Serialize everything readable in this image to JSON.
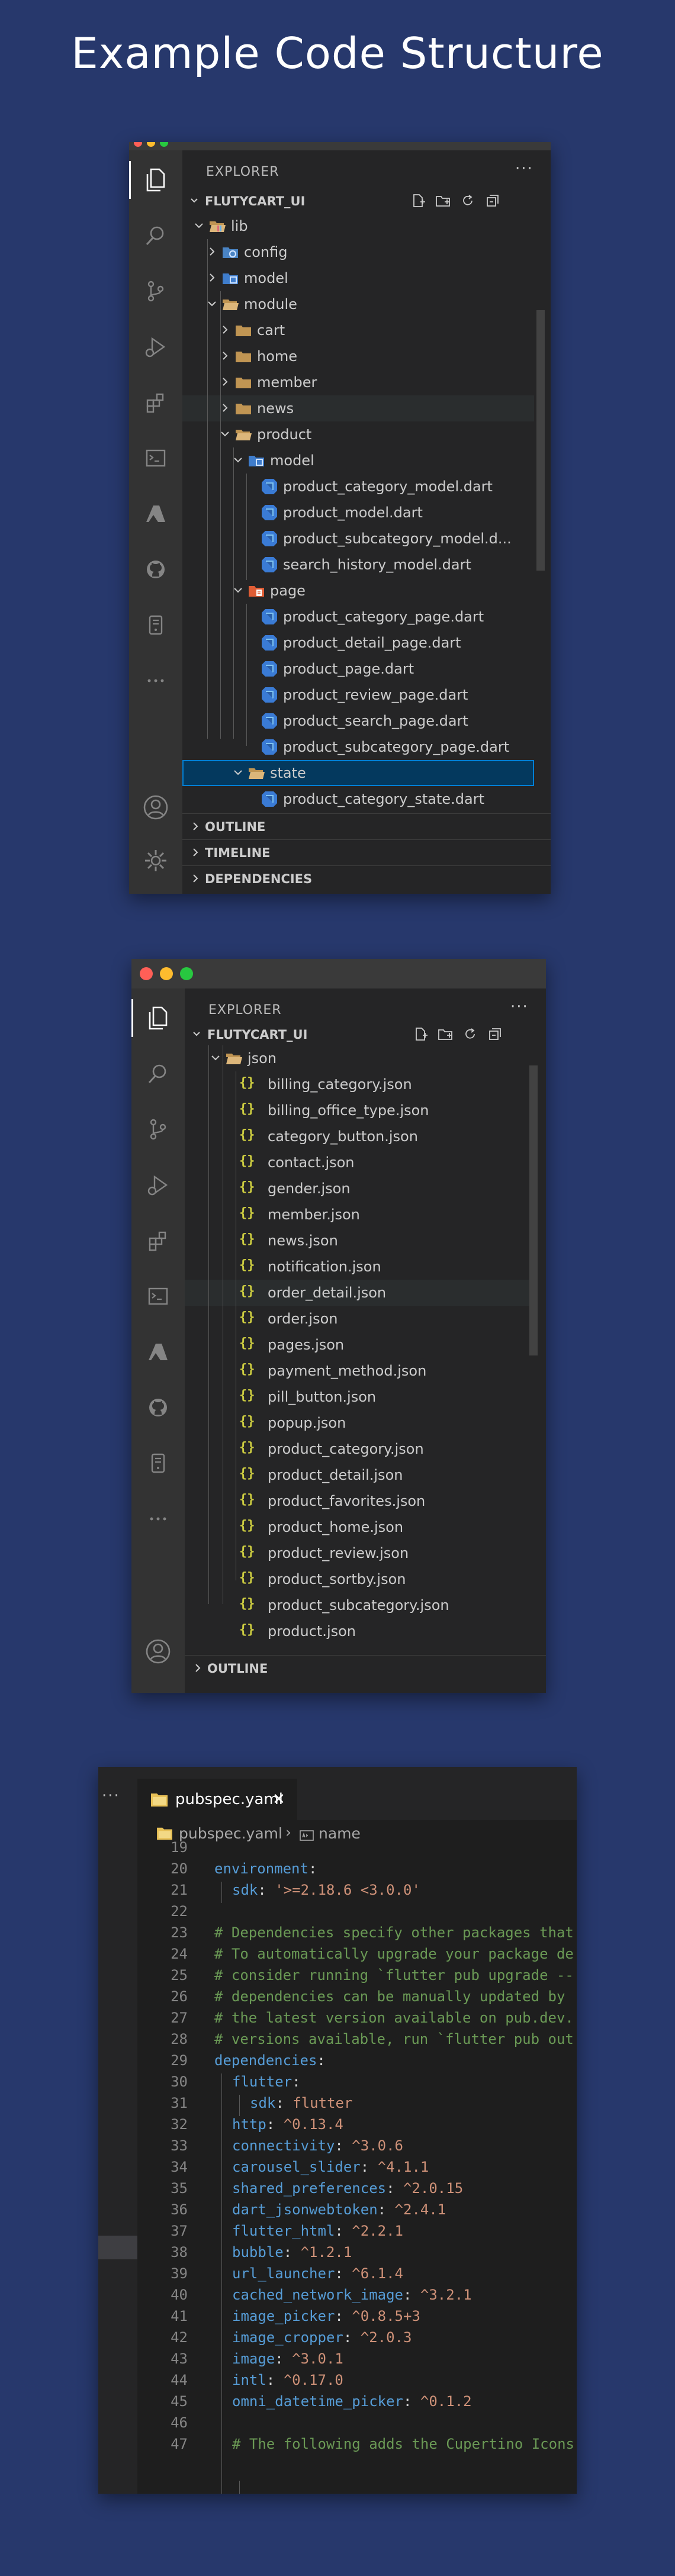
{
  "page": {
    "title": "Example Code Structure",
    "background": "#27386c"
  },
  "window1": {
    "explorer_label": "EXPLORER",
    "more_label": "···",
    "project_name": "FLUTYCART_UI",
    "tree": [
      {
        "label": "lib",
        "icon": "folder-lib-icon",
        "expanded": true
      },
      {
        "label": "config",
        "icon": "folder-config-icon",
        "expanded": false
      },
      {
        "label": "model",
        "icon": "folder-model-icon",
        "expanded": false
      },
      {
        "label": "module",
        "icon": "folder-open-icon",
        "expanded": true
      },
      {
        "label": "cart",
        "icon": "folder-icon",
        "expanded": false
      },
      {
        "label": "home",
        "icon": "folder-icon",
        "expanded": false
      },
      {
        "label": "member",
        "icon": "folder-icon",
        "expanded": false
      },
      {
        "label": "news",
        "icon": "folder-icon",
        "expanded": false
      },
      {
        "label": "product",
        "icon": "folder-open-icon",
        "expanded": true
      },
      {
        "label": "model",
        "icon": "folder-model-icon",
        "expanded": true
      },
      {
        "label": "product_category_model.dart",
        "icon": "dart-file-icon"
      },
      {
        "label": "product_model.dart",
        "icon": "dart-file-icon"
      },
      {
        "label": "product_subcategory_model.d...",
        "icon": "dart-file-icon"
      },
      {
        "label": "search_history_model.dart",
        "icon": "dart-file-icon"
      },
      {
        "label": "page",
        "icon": "folder-page-icon",
        "expanded": true
      },
      {
        "label": "product_category_page.dart",
        "icon": "dart-file-icon"
      },
      {
        "label": "product_detail_page.dart",
        "icon": "dart-file-icon"
      },
      {
        "label": "product_page.dart",
        "icon": "dart-file-icon"
      },
      {
        "label": "product_review_page.dart",
        "icon": "dart-file-icon"
      },
      {
        "label": "product_search_page.dart",
        "icon": "dart-file-icon"
      },
      {
        "label": "product_subcategory_page.dart",
        "icon": "dart-file-icon"
      },
      {
        "label": "state",
        "icon": "folder-open-icon",
        "expanded": true,
        "selected": true
      },
      {
        "label": "product_category_state.dart",
        "icon": "dart-file-icon"
      }
    ],
    "sections": [
      "OUTLINE",
      "TIMELINE",
      "DEPENDENCIES"
    ]
  },
  "window2": {
    "explorer_label": "EXPLORER",
    "more_label": "···",
    "project_name": "FLUTYCART_UI",
    "folder": "json",
    "files": [
      "billing_category.json",
      "billing_office_type.json",
      "category_button.json",
      "contact.json",
      "gender.json",
      "member.json",
      "news.json",
      "notification.json",
      "order_detail.json",
      "order.json",
      "pages.json",
      "payment_method.json",
      "pill_button.json",
      "popup.json",
      "product_category.json",
      "product_detail.json",
      "product_favorites.json",
      "product_home.json",
      "product_review.json",
      "product_sortby.json",
      "product_subcategory.json",
      "product.json"
    ],
    "json_icon": "{}",
    "sections": [
      "OUTLINE"
    ]
  },
  "window3": {
    "more_label": "···",
    "tab_label": "pubspec.yaml",
    "close_icon_glyph": "✕",
    "breadcrumb_file": "pubspec.yaml",
    "breadcrumb_sep": "›",
    "breadcrumb_symbol": "name",
    "lines": [
      {
        "n": "19",
        "indent": 0,
        "parts": []
      },
      {
        "n": "20",
        "indent": 0,
        "parts": [
          {
            "t": "environment",
            "c": "k"
          },
          {
            "t": ":",
            "c": "p"
          }
        ]
      },
      {
        "n": "21",
        "indent": 1,
        "parts": [
          {
            "t": "sdk",
            "c": "k"
          },
          {
            "t": ": ",
            "c": "p"
          },
          {
            "t": "'>=2.18.6 <3.0.0'",
            "c": "s"
          }
        ]
      },
      {
        "n": "22",
        "indent": 0,
        "parts": []
      },
      {
        "n": "23",
        "indent": 0,
        "parts": [
          {
            "t": "# Dependencies specify other packages that",
            "c": "c"
          }
        ]
      },
      {
        "n": "24",
        "indent": 0,
        "parts": [
          {
            "t": "# To automatically upgrade your package de",
            "c": "c"
          }
        ]
      },
      {
        "n": "25",
        "indent": 0,
        "parts": [
          {
            "t": "# consider running `flutter pub upgrade --",
            "c": "c"
          }
        ]
      },
      {
        "n": "26",
        "indent": 0,
        "parts": [
          {
            "t": "# dependencies can be manually updated by",
            "c": "c"
          }
        ]
      },
      {
        "n": "27",
        "indent": 0,
        "parts": [
          {
            "t": "# the latest version available on pub.dev.",
            "c": "c"
          }
        ]
      },
      {
        "n": "28",
        "indent": 0,
        "parts": [
          {
            "t": "# versions available, run `flutter pub out",
            "c": "c"
          }
        ]
      },
      {
        "n": "29",
        "indent": 0,
        "parts": [
          {
            "t": "dependencies",
            "c": "k"
          },
          {
            "t": ":",
            "c": "p"
          }
        ]
      },
      {
        "n": "30",
        "indent": 1,
        "parts": [
          {
            "t": "flutter",
            "c": "k"
          },
          {
            "t": ":",
            "c": "p"
          }
        ]
      },
      {
        "n": "31",
        "indent": 2,
        "parts": [
          {
            "t": "sdk",
            "c": "k"
          },
          {
            "t": ": ",
            "c": "p"
          },
          {
            "t": "flutter",
            "c": "s"
          }
        ]
      },
      {
        "n": "32",
        "indent": 1,
        "parts": [
          {
            "t": "http",
            "c": "k"
          },
          {
            "t": ": ",
            "c": "p"
          },
          {
            "t": "^0.13.4",
            "c": "s"
          }
        ]
      },
      {
        "n": "33",
        "indent": 1,
        "parts": [
          {
            "t": "connectivity",
            "c": "k"
          },
          {
            "t": ": ",
            "c": "p"
          },
          {
            "t": "^3.0.6",
            "c": "s"
          }
        ]
      },
      {
        "n": "34",
        "indent": 1,
        "parts": [
          {
            "t": "carousel_slider",
            "c": "k"
          },
          {
            "t": ": ",
            "c": "p"
          },
          {
            "t": "^4.1.1",
            "c": "s"
          }
        ]
      },
      {
        "n": "35",
        "indent": 1,
        "parts": [
          {
            "t": "shared_preferences",
            "c": "k"
          },
          {
            "t": ": ",
            "c": "p"
          },
          {
            "t": "^2.0.15",
            "c": "s"
          }
        ]
      },
      {
        "n": "36",
        "indent": 1,
        "parts": [
          {
            "t": "dart_jsonwebtoken",
            "c": "k"
          },
          {
            "t": ": ",
            "c": "p"
          },
          {
            "t": "^2.4.1",
            "c": "s"
          }
        ]
      },
      {
        "n": "37",
        "indent": 1,
        "parts": [
          {
            "t": "flutter_html",
            "c": "k"
          },
          {
            "t": ": ",
            "c": "p"
          },
          {
            "t": "^2.2.1",
            "c": "s"
          }
        ]
      },
      {
        "n": "38",
        "indent": 1,
        "parts": [
          {
            "t": "bubble",
            "c": "k"
          },
          {
            "t": ": ",
            "c": "p"
          },
          {
            "t": "^1.2.1",
            "c": "s"
          }
        ]
      },
      {
        "n": "39",
        "indent": 1,
        "parts": [
          {
            "t": "url_launcher",
            "c": "k"
          },
          {
            "t": ": ",
            "c": "p"
          },
          {
            "t": "^6.1.4",
            "c": "s"
          }
        ]
      },
      {
        "n": "40",
        "indent": 1,
        "parts": [
          {
            "t": "cached_network_image",
            "c": "k"
          },
          {
            "t": ": ",
            "c": "p"
          },
          {
            "t": "^3.2.1",
            "c": "s"
          }
        ]
      },
      {
        "n": "41",
        "indent": 1,
        "parts": [
          {
            "t": "image_picker",
            "c": "k"
          },
          {
            "t": ": ",
            "c": "p"
          },
          {
            "t": "^0.8.5+3",
            "c": "s"
          }
        ]
      },
      {
        "n": "42",
        "indent": 1,
        "parts": [
          {
            "t": "image_cropper",
            "c": "k"
          },
          {
            "t": ": ",
            "c": "p"
          },
          {
            "t": "^2.0.3",
            "c": "s"
          }
        ]
      },
      {
        "n": "43",
        "indent": 1,
        "parts": [
          {
            "t": "image",
            "c": "k"
          },
          {
            "t": ": ",
            "c": "p"
          },
          {
            "t": "^3.0.1",
            "c": "s"
          }
        ]
      },
      {
        "n": "44",
        "indent": 1,
        "parts": [
          {
            "t": "intl",
            "c": "k"
          },
          {
            "t": ": ",
            "c": "p"
          },
          {
            "t": "^0.17.0",
            "c": "s"
          }
        ]
      },
      {
        "n": "45",
        "indent": 1,
        "parts": [
          {
            "t": "omni_datetime_picker",
            "c": "k"
          },
          {
            "t": ": ",
            "c": "p"
          },
          {
            "t": "^0.1.2",
            "c": "s"
          }
        ]
      },
      {
        "n": "46",
        "indent": 0,
        "parts": []
      },
      {
        "n": "47",
        "indent": 1,
        "parts": [
          {
            "t": "# The following adds the Cupertino Icons",
            "c": "c"
          }
        ]
      }
    ]
  }
}
